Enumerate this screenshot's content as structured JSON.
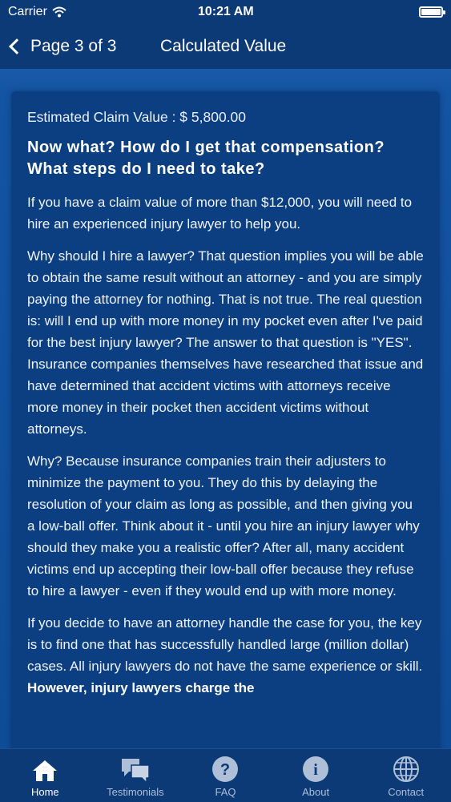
{
  "status": {
    "carrier": "Carrier",
    "time": "10:21 AM"
  },
  "nav": {
    "back_label": "Page 3 of 3",
    "title": "Calculated Value"
  },
  "content": {
    "estimate": "Estimated Claim Value : $ 5,800.00",
    "heading": "Now what? How do I get that compensation? What steps do I need to take?",
    "p1": "If you have a claim value of more than $12,000, you will need to hire an experienced injury lawyer to help you.",
    "p2": "Why should I hire a lawyer? That question implies you will be able to obtain the same result without an attorney - and you are simply paying the attorney for nothing. That is not true. The real question is: will I end up with more money in my pocket even after I've paid for the best injury lawyer? The answer to that question is \"YES\". Insurance companies themselves have researched that issue and have determined that accident victims with attorneys receive more money in their pocket then accident victims without attorneys.",
    "p3": "Why? Because insurance companies train their adjusters to minimize the payment to you. They do this by delaying the resolution of your claim as long as possible, and then giving you a low-ball offer. Think about it - until you hire an injury lawyer why should they make you a realistic offer? After all, many accident victims end up accepting their low-ball offer because they refuse to hire a lawyer - even if they would end up with more money.",
    "p4_text": "If you decide to have an attorney handle the case for you, the key is to find one that has successfully handled large (million dollar) cases. All injury lawyers do not have the same experience or skill. ",
    "p4_bold": "However, injury lawyers charge the"
  },
  "tabs": [
    {
      "label": "Home",
      "icon": "home-icon"
    },
    {
      "label": "Testimonials",
      "icon": "chat-bubbles-icon"
    },
    {
      "label": "FAQ",
      "icon": "question-icon"
    },
    {
      "label": "About",
      "icon": "info-icon"
    },
    {
      "label": "Contact",
      "icon": "globe-icon"
    }
  ]
}
